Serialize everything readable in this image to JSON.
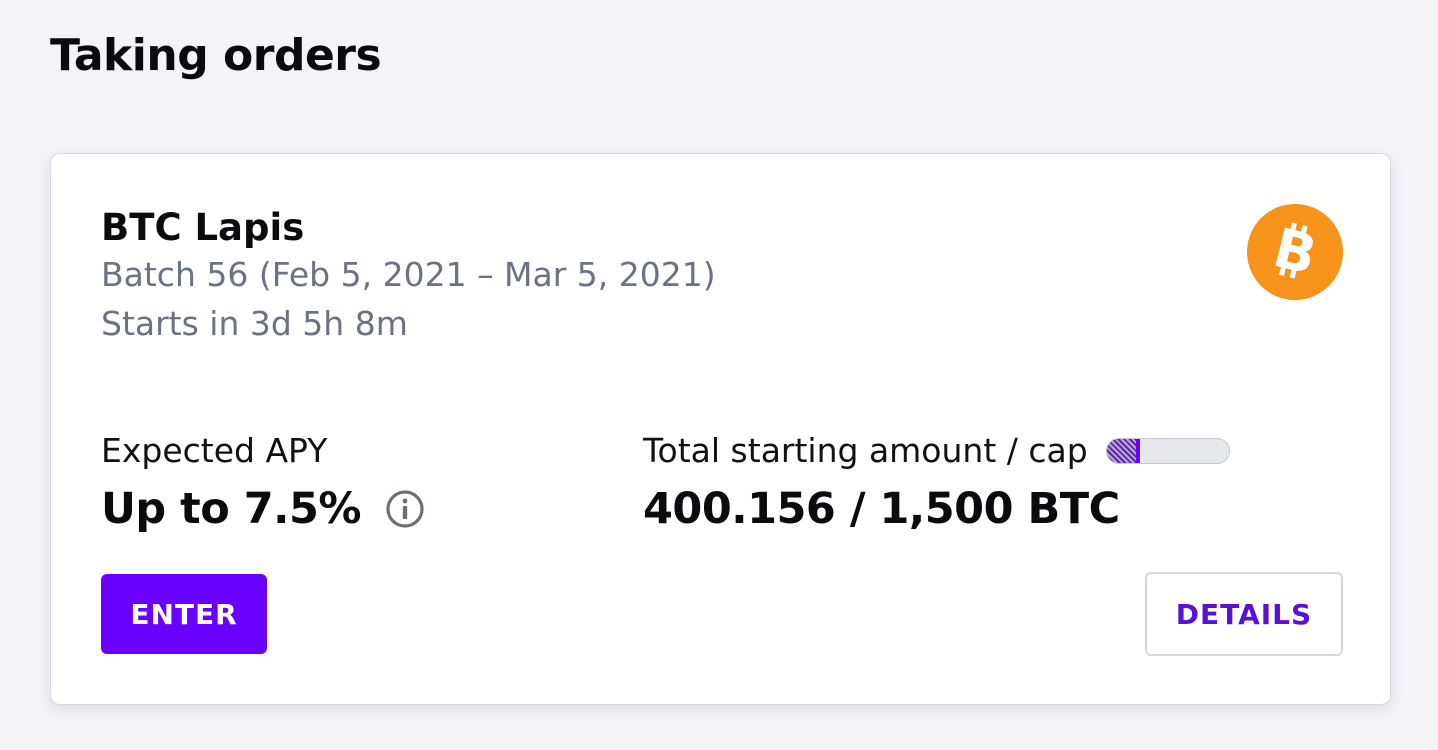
{
  "page": {
    "section_title": "Taking orders"
  },
  "card": {
    "name": "BTC Lapis",
    "batch": "Batch 56 (Feb 5, 2021 – Mar 5, 2021)",
    "starts": "Starts in 3d 5h 8m",
    "coin_icon": "bitcoin-icon",
    "apy": {
      "label": "Expected APY",
      "value": "Up to 7.5%",
      "info_icon": "info-icon"
    },
    "total": {
      "label": "Total starting amount / cap",
      "value": "400.156 / 1,500 BTC",
      "progress_fraction": 0.27
    },
    "enter_label": "ENTER",
    "details_label": "DETAILS"
  },
  "colors": {
    "accent": "#6a00ff",
    "bitcoin": "#f7931a",
    "muted_text": "#6b7380",
    "background": "#f3f3f8"
  }
}
